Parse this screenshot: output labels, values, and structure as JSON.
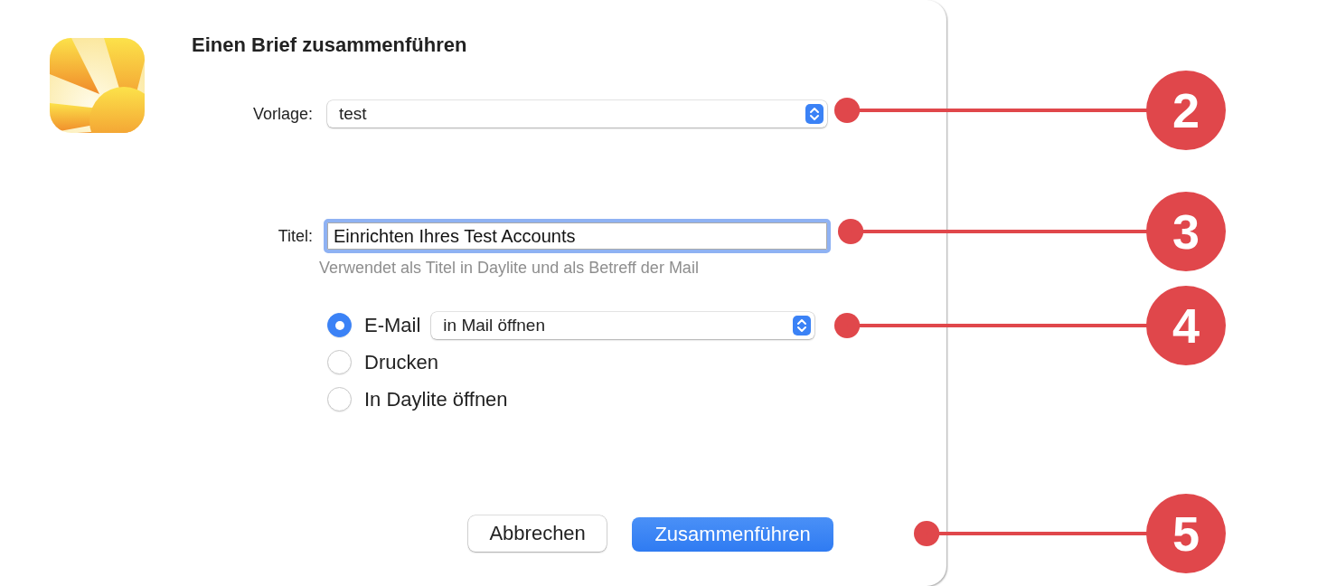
{
  "dialog": {
    "title": "Einen Brief zusammenführen",
    "template": {
      "label": "Vorlage:",
      "value": "test"
    },
    "title_field": {
      "label": "Titel:",
      "value": "Einrichten Ihres Test Accounts",
      "focused": true,
      "hint": "Verwendet als Titel in Daylite und als Betreff der Mail"
    },
    "output_options": [
      {
        "label": "E-Mail",
        "selected": true,
        "popup": "in Mail öffnen"
      },
      {
        "label": "Drucken",
        "selected": false
      },
      {
        "label": "In Daylite öffnen",
        "selected": false
      }
    ],
    "buttons": [
      {
        "label": "Abbrechen",
        "kind": "cancel"
      },
      {
        "label": "Zusammenführen",
        "kind": "default"
      }
    ]
  },
  "callouts": [
    {
      "number": "2"
    },
    {
      "number": "3"
    },
    {
      "number": "4"
    },
    {
      "number": "5"
    }
  ]
}
